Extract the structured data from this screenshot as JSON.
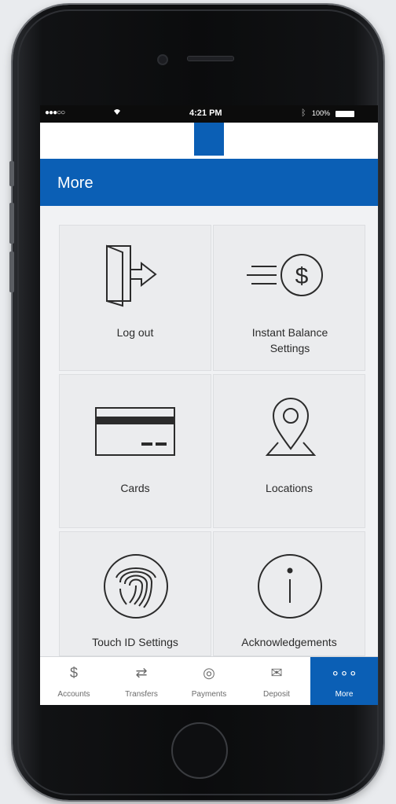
{
  "status_bar": {
    "signal": "●●●○○",
    "time": "4:21 PM",
    "battery": "100%"
  },
  "header": {
    "title": "More"
  },
  "menu": {
    "items": [
      {
        "label": "Log out",
        "icon": "logout-door-icon"
      },
      {
        "label": "Instant Balance Settings",
        "icon": "instant-balance-dollar-icon"
      },
      {
        "label": "Cards",
        "icon": "credit-card-icon"
      },
      {
        "label": "Locations",
        "icon": "location-pin-icon"
      },
      {
        "label": "Touch ID Settings",
        "icon": "fingerprint-icon"
      },
      {
        "label": "Acknowledgements",
        "icon": "info-icon"
      }
    ]
  },
  "tabs": [
    {
      "label": "Accounts",
      "icon": "$"
    },
    {
      "label": "Transfers",
      "icon": "⇄"
    },
    {
      "label": "Payments",
      "icon": "◎"
    },
    {
      "label": "Deposit",
      "icon": "✉"
    },
    {
      "label": "More",
      "icon": "∘∘∘",
      "active": true
    }
  ],
  "colors": {
    "brand_blue": "#0b5fb5",
    "tile_bg": "#ebecee"
  }
}
